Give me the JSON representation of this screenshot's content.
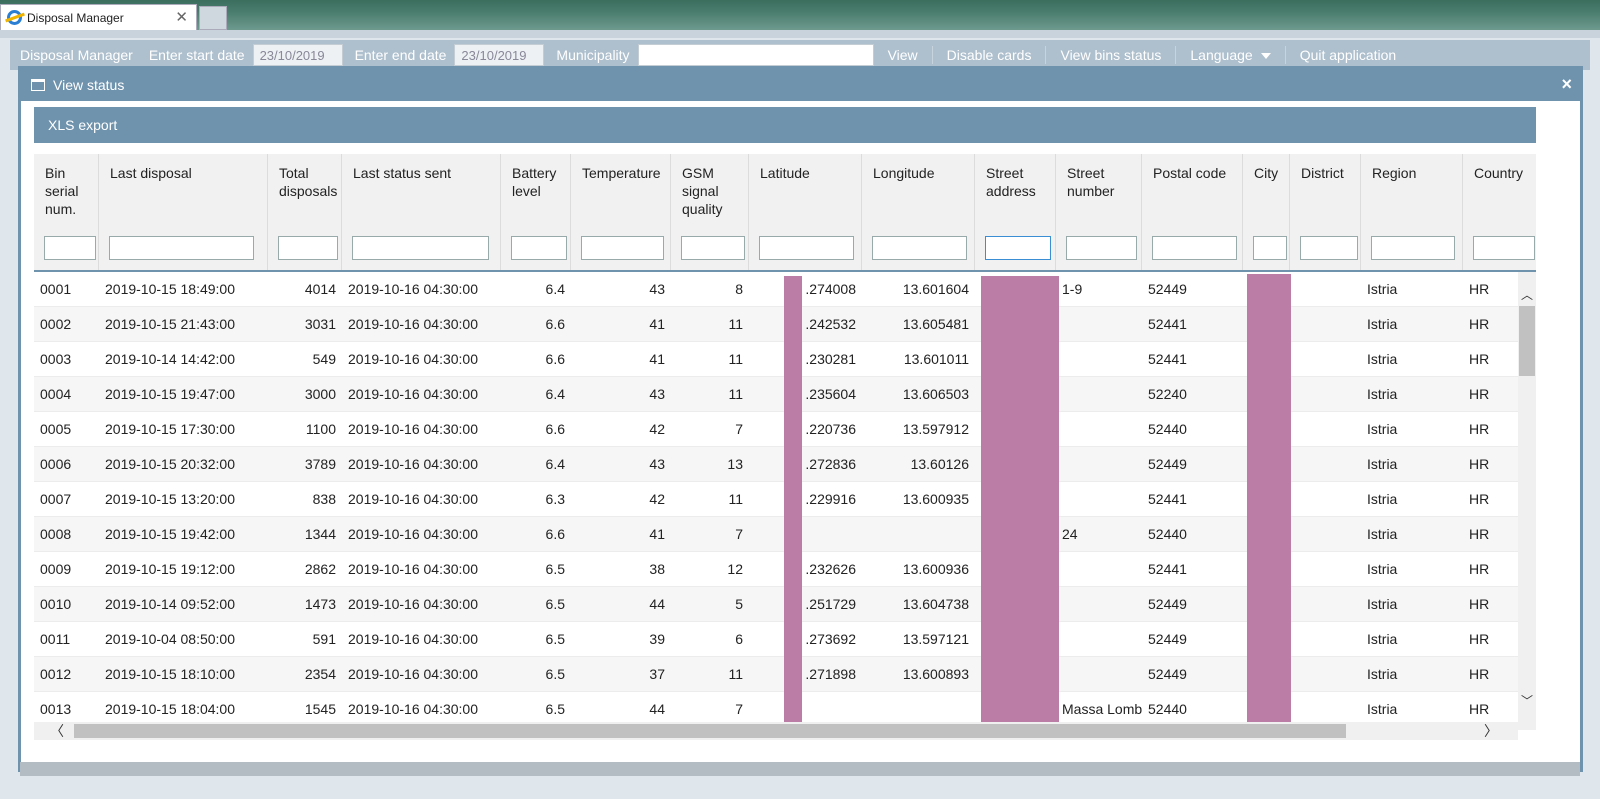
{
  "browser": {
    "tab_title": "Disposal Manager",
    "tab_close": "✕"
  },
  "toolbar": {
    "app_name": "Disposal Manager",
    "start_label": "Enter start date",
    "start_value": "23/10/2019",
    "end_label": "Enter end date",
    "end_value": "23/10/2019",
    "municipality_label": "Municipality",
    "municipality_value": "",
    "view": "View",
    "disable_cards": "Disable cards",
    "view_bins_status": "View bins status",
    "language": "Language",
    "quit": "Quit application"
  },
  "modal": {
    "title": "View status",
    "close": "×",
    "export": "XLS export"
  },
  "grid": {
    "columns": [
      "Bin serial num.",
      "Last disposal",
      "Total disposals",
      "Last status sent",
      "Battery level",
      "Temperature",
      "GSM signal quality",
      "Latitude",
      "Longitude",
      "Street address",
      "Street number",
      "Postal code",
      "City",
      "District",
      "Region",
      "Country"
    ],
    "rows": [
      [
        "0001",
        "2019-10-15 18:49:00",
        "4014",
        "2019-10-16 04:30:00",
        "6.4",
        "43",
        "8",
        ".274008",
        "13.601604",
        "",
        "1-9",
        "52449",
        "",
        "",
        "Istria",
        "HR"
      ],
      [
        "0002",
        "2019-10-15 21:43:00",
        "3031",
        "2019-10-16 04:30:00",
        "6.6",
        "41",
        "11",
        ".242532",
        "13.605481",
        "",
        "",
        "52441",
        "",
        "",
        "Istria",
        "HR"
      ],
      [
        "0003",
        "2019-10-14 14:42:00",
        "549",
        "2019-10-16 04:30:00",
        "6.6",
        "41",
        "11",
        ".230281",
        "13.601011",
        "",
        "",
        "52441",
        "",
        "",
        "Istria",
        "HR"
      ],
      [
        "0004",
        "2019-10-15 19:47:00",
        "3000",
        "2019-10-16 04:30:00",
        "6.4",
        "43",
        "11",
        ".235604",
        "13.606503",
        "",
        "",
        "52240",
        "",
        "",
        "Istria",
        "HR"
      ],
      [
        "0005",
        "2019-10-15 17:30:00",
        "1100",
        "2019-10-16 04:30:00",
        "6.6",
        "42",
        "7",
        ".220736",
        "13.597912",
        "",
        "",
        "52440",
        "",
        "",
        "Istria",
        "HR"
      ],
      [
        "0006",
        "2019-10-15 20:32:00",
        "3789",
        "2019-10-16 04:30:00",
        "6.4",
        "43",
        "13",
        ".272836",
        "13.60126",
        "",
        "",
        "52449",
        "",
        "",
        "Istria",
        "HR"
      ],
      [
        "0007",
        "2019-10-15 13:20:00",
        "838",
        "2019-10-16 04:30:00",
        "6.3",
        "42",
        "11",
        ".229916",
        "13.600935",
        "",
        "",
        "52441",
        "",
        "",
        "Istria",
        "HR"
      ],
      [
        "0008",
        "2019-10-15 19:42:00",
        "1344",
        "2019-10-16 04:30:00",
        "6.6",
        "41",
        "7",
        "",
        "",
        "",
        "24",
        "52440",
        "",
        "",
        "Istria",
        "HR"
      ],
      [
        "0009",
        "2019-10-15 19:12:00",
        "2862",
        "2019-10-16 04:30:00",
        "6.5",
        "38",
        "12",
        ".232626",
        "13.600936",
        "",
        "",
        "52441",
        "",
        "",
        "Istria",
        "HR"
      ],
      [
        "0010",
        "2019-10-14 09:52:00",
        "1473",
        "2019-10-16 04:30:00",
        "6.5",
        "44",
        "5",
        ".251729",
        "13.604738",
        "",
        "",
        "52449",
        "",
        "",
        "Istria",
        "HR"
      ],
      [
        "0011",
        "2019-10-04 08:50:00",
        "591",
        "2019-10-16 04:30:00",
        "6.5",
        "39",
        "6",
        ".273692",
        "13.597121",
        "",
        "",
        "52449",
        "",
        "",
        "Istria",
        "HR"
      ],
      [
        "0012",
        "2019-10-15 18:10:00",
        "2354",
        "2019-10-16 04:30:00",
        "6.5",
        "37",
        "11",
        ".271898",
        "13.600893",
        "",
        "",
        "52449",
        "",
        "",
        "Istria",
        "HR"
      ],
      [
        "0013",
        "2019-10-15 18:04:00",
        "1545",
        "2019-10-16 04:30:00",
        "6.5",
        "44",
        "7",
        "",
        "",
        "",
        "Massa Lomb",
        "52440",
        "",
        "",
        "Istria",
        "HR"
      ]
    ]
  },
  "colors": {
    "accent": "#6f93ad",
    "redaction": "#bb7da6"
  },
  "scroll": {
    "up": "︿",
    "down": "﹀",
    "left": "〈",
    "right": "〉"
  }
}
